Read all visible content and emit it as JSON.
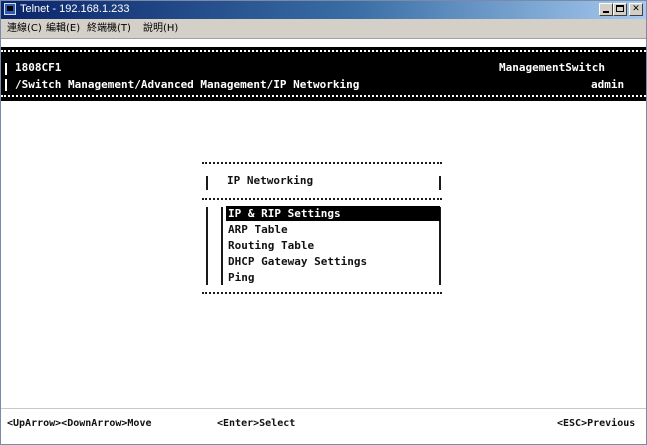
{
  "window": {
    "title": "Telnet - 192.168.1.233",
    "icon": "telnet-terminal-icon"
  },
  "menubar": {
    "items": [
      {
        "label": "連線(C)"
      },
      {
        "label": "編輯(E)"
      },
      {
        "label": "終端機(T)"
      },
      {
        "label": "說明(H)"
      }
    ]
  },
  "header": {
    "device": "1808CF1",
    "path": "/Switch Management/Advanced Management/IP Networking",
    "product": "ManagementSwitch",
    "user": "admin"
  },
  "menu": {
    "title": "IP Networking",
    "options": [
      {
        "label": "IP & RIP Settings",
        "selected": true
      },
      {
        "label": "ARP Table",
        "selected": false
      },
      {
        "label": "Routing Table",
        "selected": false
      },
      {
        "label": "DHCP Gateway Settings",
        "selected": false
      },
      {
        "label": "Ping",
        "selected": false
      }
    ]
  },
  "footer": {
    "navigate": "<UpArrow><DownArrow>Move",
    "select": "<Enter>Select",
    "previous": "<ESC>Previous"
  },
  "colors": {
    "terminal_bg": "#000000",
    "terminal_fg": "#ffffff",
    "selection_bg": "#000000",
    "titlebar_start": "#0a246a"
  }
}
